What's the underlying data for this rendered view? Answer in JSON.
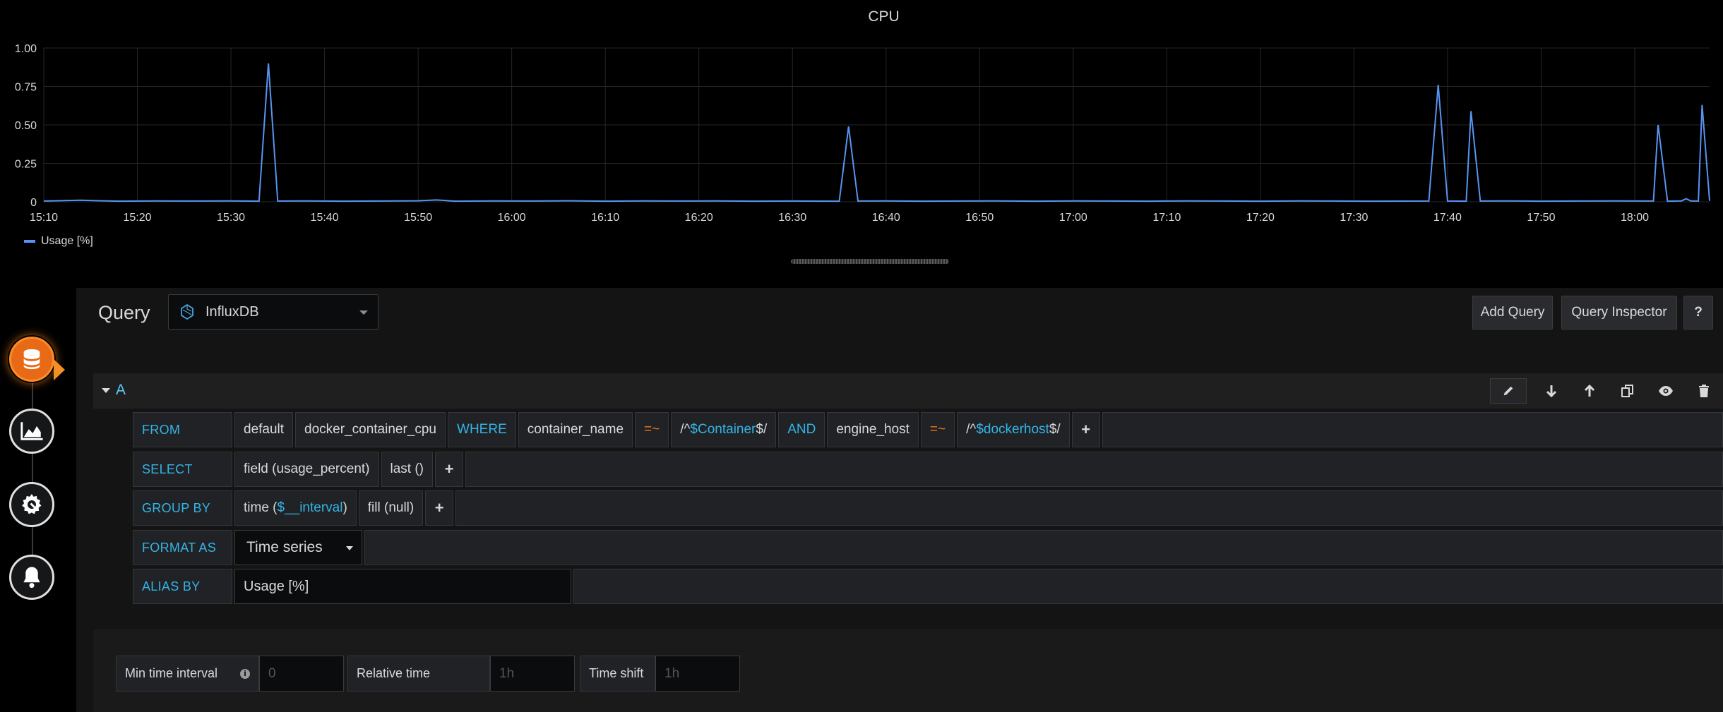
{
  "chart_data": {
    "type": "line",
    "title": "CPU",
    "x_ticks": [
      "15:10",
      "15:20",
      "15:30",
      "15:40",
      "15:50",
      "16:00",
      "16:10",
      "16:20",
      "16:30",
      "16:40",
      "16:50",
      "17:00",
      "17:10",
      "17:20",
      "17:30",
      "17:40",
      "17:50",
      "18:00"
    ],
    "y_ticks": [
      "1.00",
      "0.75",
      "0.50",
      "0.25",
      "0"
    ],
    "ylim": [
      0,
      1
    ],
    "xlim": [
      "15:10",
      "18:08"
    ],
    "grid": true,
    "legend_position": "bottom-left",
    "series": [
      {
        "name": "Usage [%]",
        "color": "#5794f2",
        "points": [
          [
            "15:10",
            0.005
          ],
          [
            "15:14",
            0.01
          ],
          [
            "15:18",
            0.004
          ],
          [
            "15:22",
            0.006
          ],
          [
            "15:26",
            0.005
          ],
          [
            "15:30",
            0.006
          ],
          [
            "15:33",
            0.004
          ],
          [
            "15:34",
            0.9
          ],
          [
            "15:35",
            0.005
          ],
          [
            "15:38",
            0.006
          ],
          [
            "15:42",
            0.004
          ],
          [
            "15:46",
            0.005
          ],
          [
            "15:50",
            0.007
          ],
          [
            "15:52",
            0.012
          ],
          [
            "15:54",
            0.004
          ],
          [
            "15:58",
            0.006
          ],
          [
            "16:02",
            0.005
          ],
          [
            "16:06",
            0.007
          ],
          [
            "16:10",
            0.004
          ],
          [
            "16:14",
            0.006
          ],
          [
            "16:18",
            0.005
          ],
          [
            "16:22",
            0.006
          ],
          [
            "16:26",
            0.004
          ],
          [
            "16:30",
            0.005
          ],
          [
            "16:35",
            0.004
          ],
          [
            "16:36",
            0.49
          ],
          [
            "16:37",
            0.005
          ],
          [
            "16:40",
            0.006
          ],
          [
            "16:44",
            0.004
          ],
          [
            "16:48",
            0.005
          ],
          [
            "16:52",
            0.006
          ],
          [
            "16:56",
            0.004
          ],
          [
            "17:00",
            0.006
          ],
          [
            "17:04",
            0.005
          ],
          [
            "17:08",
            0.004
          ],
          [
            "17:12",
            0.006
          ],
          [
            "17:16",
            0.005
          ],
          [
            "17:20",
            0.004
          ],
          [
            "17:24",
            0.006
          ],
          [
            "17:28",
            0.005
          ],
          [
            "17:32",
            0.004
          ],
          [
            "17:38",
            0.005
          ],
          [
            "17:39",
            0.76
          ],
          [
            "17:40",
            0.005
          ],
          [
            "17:42",
            0.004
          ],
          [
            "17:42.5",
            0.59
          ],
          [
            "17:43.5",
            0.005
          ],
          [
            "17:46",
            0.006
          ],
          [
            "17:50",
            0.004
          ],
          [
            "17:54",
            0.005
          ],
          [
            "17:58",
            0.006
          ],
          [
            "18:02",
            0.005
          ],
          [
            "18:02.5",
            0.5
          ],
          [
            "18:03.5",
            0.004
          ],
          [
            "18:05",
            0.006
          ],
          [
            "18:05.5",
            0.02
          ],
          [
            "18:06",
            0.005
          ],
          [
            "18:06.8",
            0.005
          ],
          [
            "18:07.2",
            0.63
          ],
          [
            "18:08",
            0.006
          ]
        ]
      }
    ]
  },
  "editor": {
    "title": "Query",
    "datasource": "InfluxDB",
    "add_query": "Add Query",
    "query_inspector": "Query Inspector",
    "help": "?"
  },
  "query": {
    "ref_id": "A",
    "from": {
      "keyword": "FROM",
      "policy": "default",
      "measurement": "docker_container_cpu",
      "where_kw": "WHERE",
      "tag1": "container_name",
      "op1": "=~",
      "val1_prefix": "/^",
      "val1_var": "$Container",
      "val1_suffix": "$/",
      "and_kw": "AND",
      "tag2": "engine_host",
      "op2": "=~",
      "val2_prefix": "/^",
      "val2_var": "$dockerhost",
      "val2_suffix": "$/",
      "plus": "+"
    },
    "select": {
      "keyword": "SELECT",
      "field": "field (usage_percent)",
      "func": "last ()",
      "plus": "+"
    },
    "group_by": {
      "keyword": "GROUP BY",
      "time_prefix": "time (",
      "time_var": "$__interval",
      "time_suffix": ")",
      "fill": "fill (null)",
      "plus": "+"
    },
    "format_as": {
      "keyword": "FORMAT AS",
      "value": "Time series"
    },
    "alias_by": {
      "keyword": "ALIAS BY",
      "value": "Usage [%]"
    }
  },
  "options": {
    "min_interval_label": "Min time interval",
    "min_interval_placeholder": "0",
    "relative_time_label": "Relative time",
    "relative_time_placeholder": "1h",
    "time_shift_label": "Time shift",
    "time_shift_placeholder": "1h"
  }
}
